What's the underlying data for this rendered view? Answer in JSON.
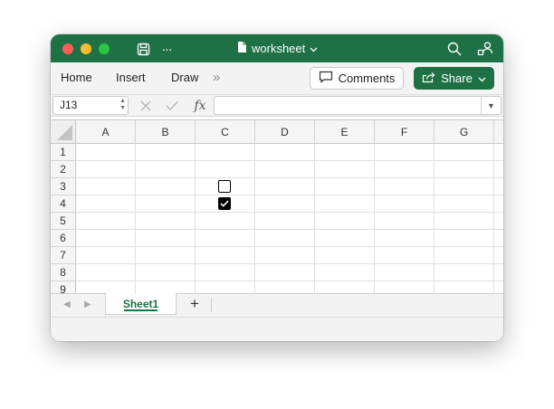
{
  "window": {
    "title": "worksheet",
    "accent_color": "#1e7145"
  },
  "titlebar": {
    "icons": [
      "save-icon",
      "more-icon",
      "document-icon",
      "chevron-down-icon",
      "search-icon",
      "collaborate-icon"
    ],
    "more_glyph": "···"
  },
  "ribbon": {
    "tabs": [
      {
        "label": "Home"
      },
      {
        "label": "Insert"
      },
      {
        "label": "Draw"
      }
    ],
    "overflow_glyph": "»",
    "comments_label": "Comments",
    "share_label": "Share"
  },
  "formula_bar": {
    "name_box_value": "J13",
    "fx_label": "fx",
    "formula_value": ""
  },
  "grid": {
    "columns": [
      "A",
      "B",
      "C",
      "D",
      "E",
      "F",
      "G"
    ],
    "rows": [
      "1",
      "2",
      "3",
      "4",
      "5",
      "6",
      "7",
      "8",
      "9"
    ],
    "cells": [
      {
        "ref": "C3",
        "type": "checkbox",
        "checked": false
      },
      {
        "ref": "C4",
        "type": "checkbox",
        "checked": true
      }
    ]
  },
  "sheets": {
    "tabs": [
      {
        "label": "Sheet1",
        "active": true
      }
    ],
    "add_glyph": "+"
  }
}
